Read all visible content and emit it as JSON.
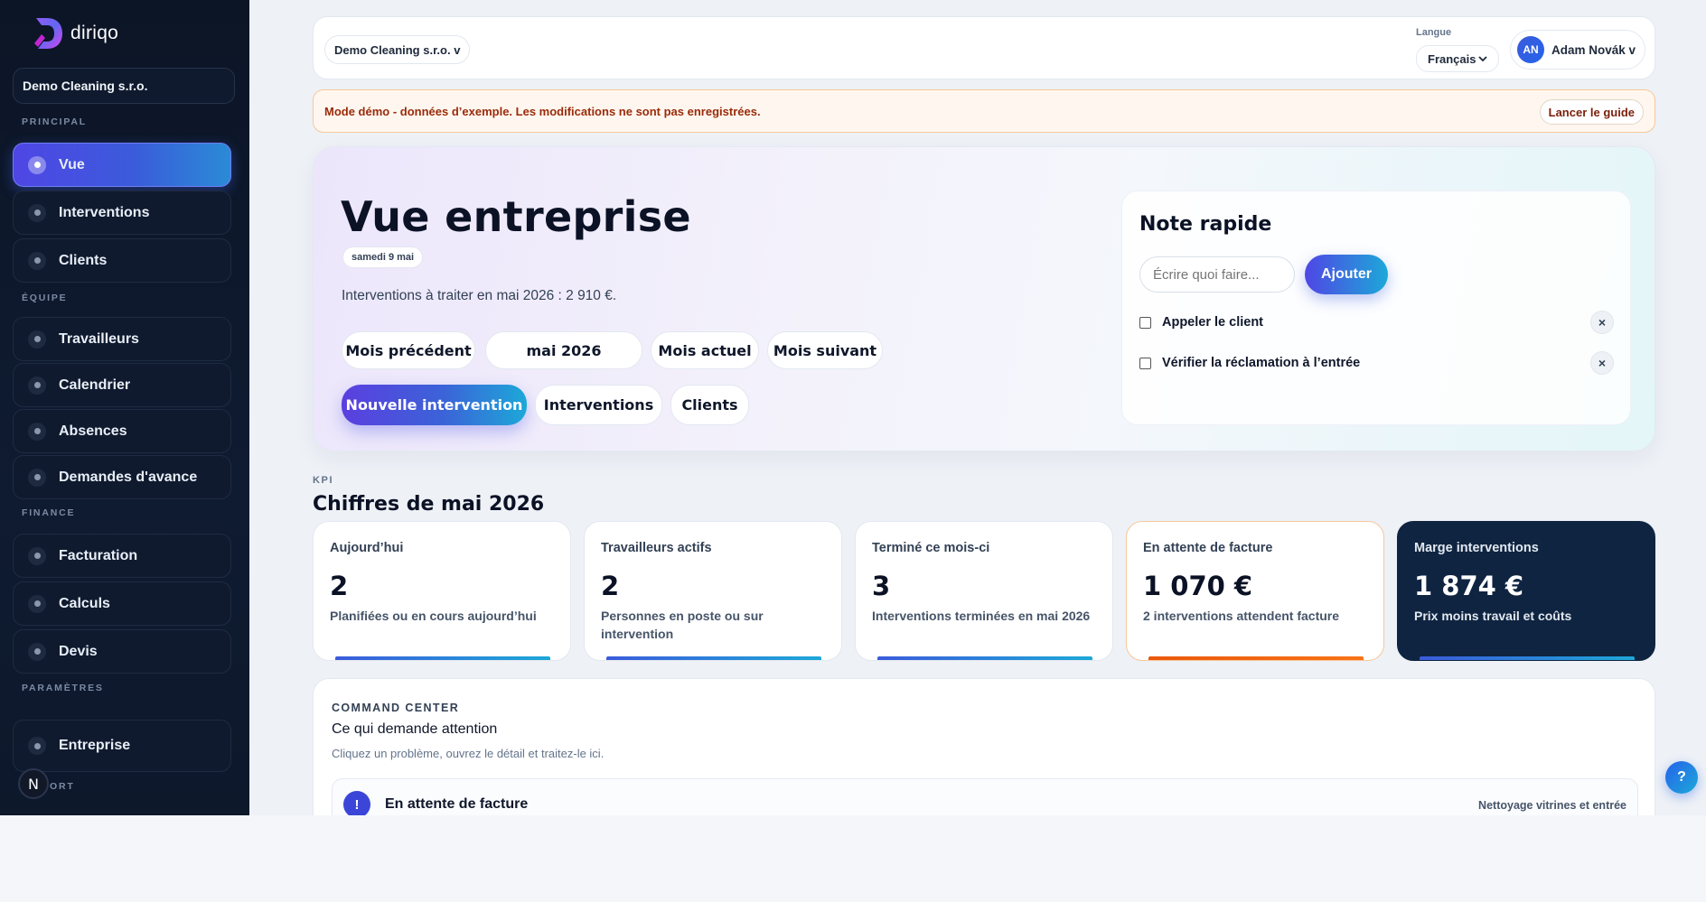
{
  "brand": {
    "name": "diriqo"
  },
  "sidebar": {
    "company": "Demo Cleaning s.r.o.",
    "sections": {
      "principal": "PRINCIPAL",
      "equipe": "ÉQUIPE",
      "finance": "FINANCE",
      "parametres": "PARAMÈTRES",
      "support_partial": "ORT"
    },
    "items": [
      {
        "label": "Vue",
        "active": true
      },
      {
        "label": "Interventions"
      },
      {
        "label": "Clients"
      },
      {
        "label": "Travailleurs"
      },
      {
        "label": "Calendrier"
      },
      {
        "label": "Absences"
      },
      {
        "label": "Demandes d'avance"
      },
      {
        "label": "Facturation"
      },
      {
        "label": "Calculs"
      },
      {
        "label": "Devis"
      },
      {
        "label": "Entreprise"
      }
    ],
    "badge": "N"
  },
  "topbar": {
    "workspace": "Demo Cleaning s.r.o. v",
    "language_label": "Langue",
    "language_value": "Français",
    "user_initials": "AN",
    "user_name": "Adam Novák v"
  },
  "demo_banner": {
    "text": "Mode démo - données d’exemple. Les modifications ne sont pas enregistrées.",
    "guide_button": "Lancer le guide"
  },
  "hero": {
    "title": "Vue entreprise",
    "date": "samedi 9 mai",
    "subtitle": "Interventions à traiter en mai 2026 : 2 910 €.",
    "month_buttons": {
      "prev": "Mois précédent",
      "current_value": "mai 2026",
      "current": "Mois actuel",
      "next": "Mois suivant"
    },
    "actions": {
      "new": "Nouvelle intervention",
      "interventions": "Interventions",
      "clients": "Clients"
    }
  },
  "quick_note": {
    "title": "Note rapide",
    "placeholder": "Écrire quoi faire...",
    "add_button": "Ajouter",
    "items": [
      {
        "label": "Appeler le client",
        "checked": false
      },
      {
        "label": "Vérifier la réclamation à l’entrée",
        "checked": false
      }
    ],
    "remove_glyph": "×"
  },
  "kpi": {
    "label": "KPI",
    "title": "Chiffres de mai 2026",
    "cards": [
      {
        "name": "Aujourd’hui",
        "value": "2",
        "desc": "Planifiées ou en cours aujourd’hui"
      },
      {
        "name": "Travailleurs actifs",
        "value": "2",
        "desc": "Personnes en poste ou sur intervention"
      },
      {
        "name": "Terminé ce mois-ci",
        "value": "3",
        "desc": "Interventions terminées en mai 2026"
      },
      {
        "name": "En attente de facture",
        "value": "1 070 €",
        "desc": "2 interventions attendent facture"
      },
      {
        "name": "Marge interventions",
        "value": "1 874 €",
        "desc": "Prix moins travail et coûts"
      }
    ]
  },
  "command_center": {
    "label": "COMMAND CENTER",
    "title": "Ce qui demande attention",
    "subtitle": "Cliquez un problème, ouvrez le détail et traitez-le ici.",
    "issue": {
      "icon": "!",
      "title": "En attente de facture",
      "meta": "Nettoyage vitrines et entrée"
    }
  },
  "help_button": "?",
  "colors": {
    "accent": "#3b5bdb",
    "sidebar_bg": "#0c1526",
    "warn": "#ea580c",
    "dark_card": "#0f2440"
  }
}
